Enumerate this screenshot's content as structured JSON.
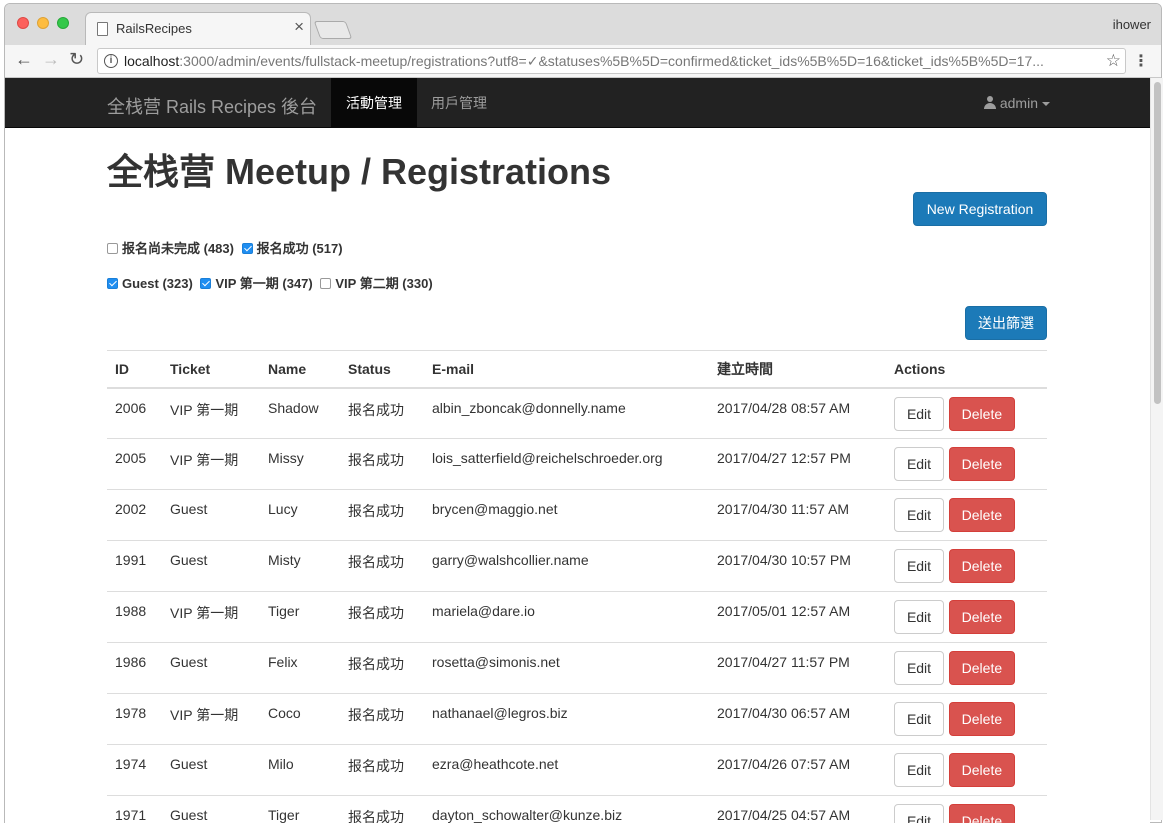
{
  "browser": {
    "tab_title": "RailsRecipes",
    "tab_close": "×",
    "profile_name": "ihower",
    "url_host": "localhost",
    "url_rest": ":3000/admin/events/fullstack-meetup/registrations?utf8=✓&statuses%5B%5D=confirmed&ticket_ids%5B%5D=16&ticket_ids%5B%5D=17...",
    "back_icon": "←",
    "forward_icon": "→",
    "reload_icon": "↻",
    "info_icon": "i",
    "star_icon": "☆",
    "menu_icon": "⋮"
  },
  "navbar": {
    "brand": "全栈营 Rails Recipes 後台",
    "items": [
      {
        "label": "活動管理",
        "active": true
      },
      {
        "label": "用戶管理",
        "active": false
      }
    ],
    "user": "admin"
  },
  "page": {
    "title": "全栈营 Meetup / Registrations",
    "new_button": "New Registration",
    "filter_button": "送出篩選",
    "status_filters": [
      {
        "label": "报名尚未完成 (483)",
        "checked": false
      },
      {
        "label": "报名成功 (517)",
        "checked": true
      }
    ],
    "ticket_filters": [
      {
        "label": "Guest (323)",
        "checked": true
      },
      {
        "label": "VIP 第一期 (347)",
        "checked": true
      },
      {
        "label": "VIP 第二期 (330)",
        "checked": false
      }
    ]
  },
  "table": {
    "headers": [
      "ID",
      "Ticket",
      "Name",
      "Status",
      "E-mail",
      "建立時間",
      "Actions"
    ],
    "edit_label": "Edit",
    "delete_label": "Delete",
    "rows": [
      {
        "id": "2006",
        "ticket": "VIP 第一期",
        "name": "Shadow",
        "status": "报名成功",
        "email": "albin_zboncak@donnelly.name",
        "created": "2017/04/28 08:57 AM"
      },
      {
        "id": "2005",
        "ticket": "VIP 第一期",
        "name": "Missy",
        "status": "报名成功",
        "email": "lois_satterfield@reichelschroeder.org",
        "created": "2017/04/27 12:57 PM"
      },
      {
        "id": "2002",
        "ticket": "Guest",
        "name": "Lucy",
        "status": "报名成功",
        "email": "brycen@maggio.net",
        "created": "2017/04/30 11:57 AM"
      },
      {
        "id": "1991",
        "ticket": "Guest",
        "name": "Misty",
        "status": "报名成功",
        "email": "garry@walshcollier.name",
        "created": "2017/04/30 10:57 PM"
      },
      {
        "id": "1988",
        "ticket": "VIP 第一期",
        "name": "Tiger",
        "status": "报名成功",
        "email": "mariela@dare.io",
        "created": "2017/05/01 12:57 AM"
      },
      {
        "id": "1986",
        "ticket": "Guest",
        "name": "Felix",
        "status": "报名成功",
        "email": "rosetta@simonis.net",
        "created": "2017/04/27 11:57 PM"
      },
      {
        "id": "1978",
        "ticket": "VIP 第一期",
        "name": "Coco",
        "status": "报名成功",
        "email": "nathanael@legros.biz",
        "created": "2017/04/30 06:57 AM"
      },
      {
        "id": "1974",
        "ticket": "Guest",
        "name": "Milo",
        "status": "报名成功",
        "email": "ezra@heathcote.net",
        "created": "2017/04/26 07:57 AM"
      },
      {
        "id": "1971",
        "ticket": "Guest",
        "name": "Tiger",
        "status": "报名成功",
        "email": "dayton_schowalter@kunze.biz",
        "created": "2017/04/25 04:57 AM"
      }
    ]
  }
}
